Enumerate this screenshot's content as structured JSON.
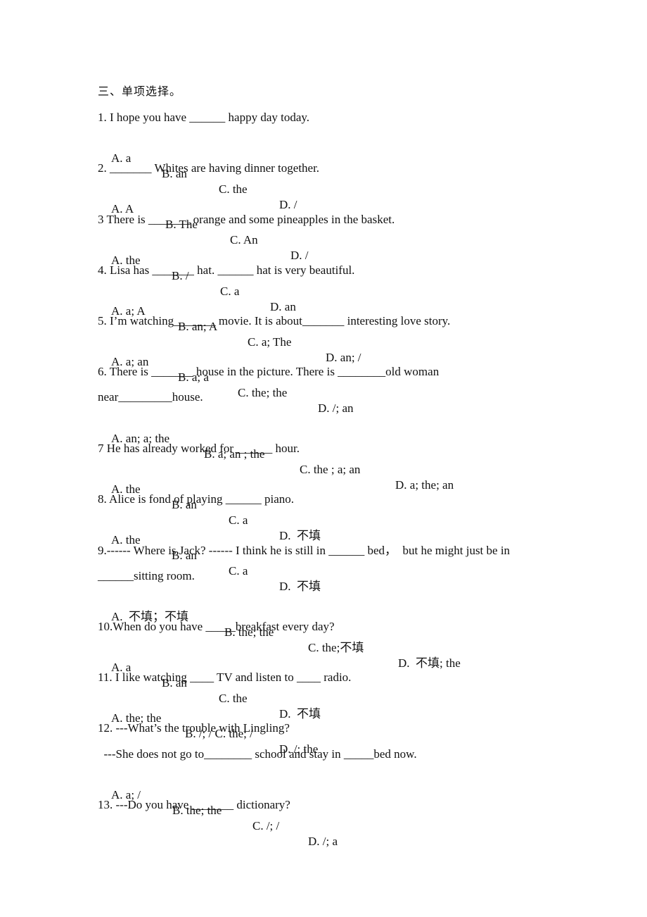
{
  "section_heading": "三、单项选择。",
  "questions": [
    {
      "stem": [
        "1. I hope you have ______ happy day today."
      ],
      "options": [
        "A. a",
        "B. an",
        "C. the",
        "D. /"
      ]
    },
    {
      "stem": [
        "2. _______ Whites are having dinner together."
      ],
      "options": [
        "A. A",
        "B. The",
        "C. An",
        "D. /"
      ]
    },
    {
      "stem": [
        "3 There is _______ orange and some pineapples in the basket."
      ],
      "options": [
        "A. the",
        "B. /",
        "C. a",
        "D. an"
      ]
    },
    {
      "stem": [
        "4. Lisa has _______ hat. ______ hat is very beautiful."
      ],
      "options": [
        "A. a; A",
        "B. an; A",
        "C. a; The",
        "D. an; /"
      ]
    },
    {
      "stem": [
        "5. I’m watching_______ movie. It is about_______ interesting love story."
      ],
      "options": [
        "A. a; an",
        "B. a; a",
        "C. the; the",
        "D. /; an"
      ]
    },
    {
      "stem": [
        "6. There is _______ house in the picture. There is ________old woman",
        "near_________house."
      ],
      "options": [
        "A. an; a; the",
        "B. a; an ; the",
        "C. the ; a; an",
        "D. a; the; an"
      ]
    },
    {
      "stem": [
        "7 He has already worked for ______ hour."
      ],
      "options": [
        "A. the",
        "B. an",
        "C. a",
        "D.  不填"
      ]
    },
    {
      "stem": [
        "8. Alice is fond of playing ______ piano."
      ],
      "options": [
        "A. the",
        "B. an",
        "C. a",
        "D.  不填"
      ]
    },
    {
      "stem": [
        "9.------ Where is Jack? ------ I think he is still in ______ bed，  but he might just be in",
        "______sitting room."
      ],
      "options": [
        "A.  不填；不填",
        "B. the; the",
        "C. the;不填",
        "D.  不填; the"
      ]
    },
    {
      "stem": [
        "10.When do you have _____breakfast every day?"
      ],
      "options": [
        "A. a",
        "B. an",
        "C. the",
        "D.  不填"
      ]
    },
    {
      "stem": [
        "11. I like watching ____ TV and listen to ____ radio."
      ],
      "options": [
        "A. the; the",
        "B. /; / C. the; /",
        "D. /; the"
      ]
    },
    {
      "stem": [
        "12. ---What’s the trouble with Lingling?",
        "  ---She does not go to________ school and stay in _____bed now."
      ],
      "options": [
        "A. a; /",
        "B. the; the",
        "C. /; /",
        "D. /; a"
      ]
    },
    {
      "stem": [
        "13. ---Do you have _______ dictionary?"
      ],
      "options": []
    }
  ]
}
